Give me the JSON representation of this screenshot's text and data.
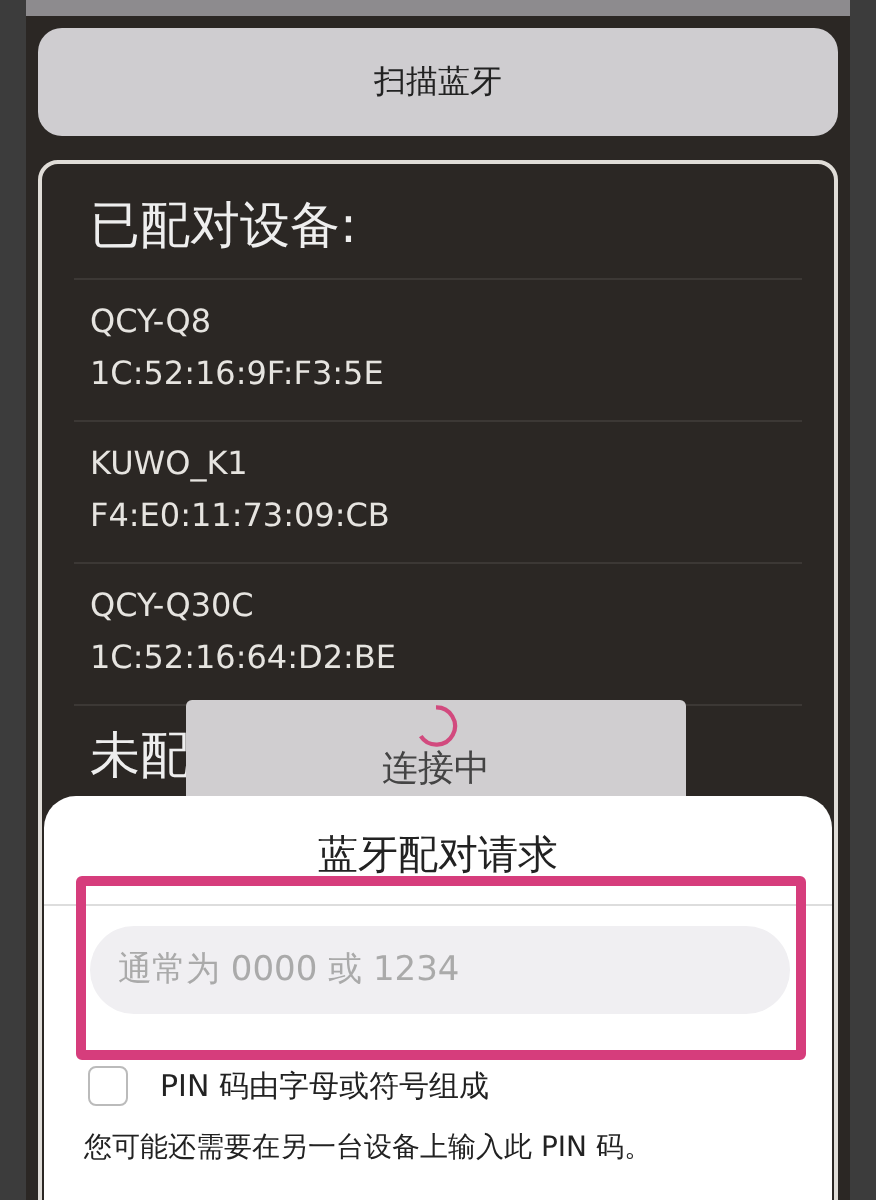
{
  "scan_button": {
    "label": "扫描蓝牙"
  },
  "paired_section": {
    "title": "已配对设备:",
    "devices": [
      {
        "name": "QCY-Q8",
        "address": "1C:52:16:9F:F3:5E"
      },
      {
        "name": "KUWO_K1",
        "address": "F4:E0:11:73:09:CB"
      },
      {
        "name": "QCY-Q30C",
        "address": "1C:52:16:64:D2:BE"
      }
    ]
  },
  "unpaired_section": {
    "title": "未配"
  },
  "connecting_dialog": {
    "message": "连接中"
  },
  "pairing_dialog": {
    "title": "蓝牙配对请求",
    "pin_field": {
      "placeholder": "通常为 0000 或 1234"
    },
    "checkbox": {
      "label": "PIN 码由字母或符号组成",
      "checked": false
    },
    "note": "您可能还需要在另一台设备上输入此 PIN 码。"
  }
}
